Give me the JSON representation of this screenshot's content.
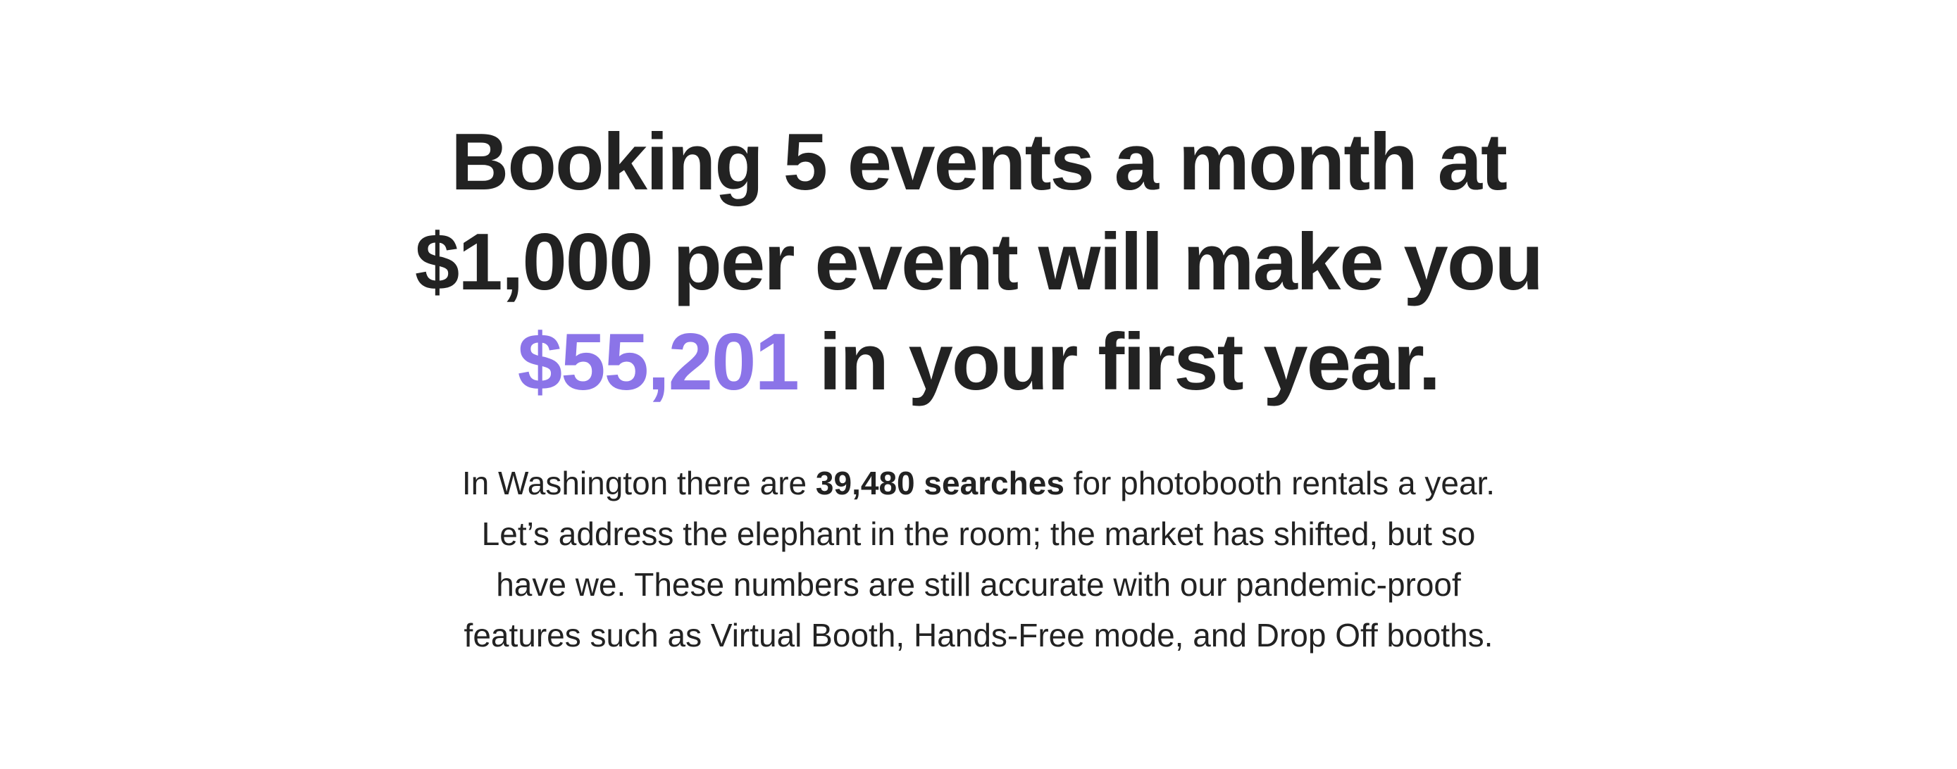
{
  "colors": {
    "text": "#222222",
    "accent": "#8b74e8",
    "background": "#ffffff"
  },
  "headline": {
    "line1": "Booking 5 events a month at",
    "line2": "$1,000 per event will make you",
    "line3_amount": "$55,201",
    "line3_rest": " in your first year."
  },
  "body": {
    "line1_prefix": "In Washington there are ",
    "line1_bold": "39,480 searches",
    "line1_suffix": " for photobooth rentals a year.",
    "line2": "Let’s address the elephant in the room; the market has shifted, but so",
    "line3": "have we. These numbers are still accurate with our pandemic-proof",
    "line4": "features such as Virtual Booth, Hands-Free mode, and Drop Off booths."
  }
}
